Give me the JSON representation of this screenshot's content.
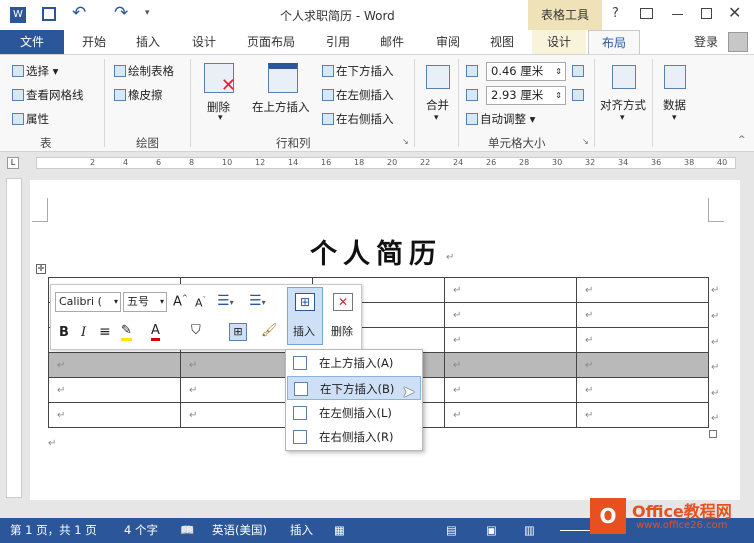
{
  "title": "个人求职简历 - Word",
  "context_tab": "表格工具",
  "tabs": [
    "文件",
    "开始",
    "插入",
    "设计",
    "页面布局",
    "引用",
    "邮件",
    "审阅",
    "视图",
    "设计",
    "布局"
  ],
  "login": "登录",
  "ribbon": {
    "table": {
      "select": "选择",
      "gridlines": "查看网格线",
      "properties": "属性",
      "label": "表"
    },
    "draw": {
      "draw_table": "绘制表格",
      "eraser": "橡皮擦",
      "label": "绘图"
    },
    "rows_cols": {
      "delete": "删除",
      "insert_above": "在上方插入",
      "insert_below": "在下方插入",
      "insert_left": "在左侧插入",
      "insert_right": "在右侧插入",
      "label": "行和列"
    },
    "merge": "合并",
    "cell_size": {
      "height": "0.46 厘米",
      "width": "2.93 厘米",
      "autofit": "自动调整",
      "label": "单元格大小"
    },
    "align": "对齐方式",
    "data": "数据"
  },
  "ruler": [
    "2",
    "4",
    "6",
    "8",
    "10",
    "12",
    "14",
    "16",
    "18",
    "20",
    "22",
    "24",
    "26",
    "28",
    "30",
    "32",
    "34",
    "36",
    "38",
    "40"
  ],
  "doc_title": "个人简历",
  "mini": {
    "font": "Calibri (",
    "size": "五号",
    "insert": "插入",
    "delete": "删除"
  },
  "menu": [
    "在上方插入(A)",
    "在下方插入(B)",
    "在左侧插入(L)",
    "在右侧插入(R)"
  ],
  "status": {
    "page": "第 1 页，共 1 页",
    "words": "4 个字",
    "lang": "英语(美国)",
    "mode": "插入"
  },
  "watermark": {
    "name": "Office教程网",
    "url": "www.office26.com"
  },
  "colors": {
    "accent": "#2b579a",
    "context": "#c9a13a",
    "status": "#2b579a"
  }
}
